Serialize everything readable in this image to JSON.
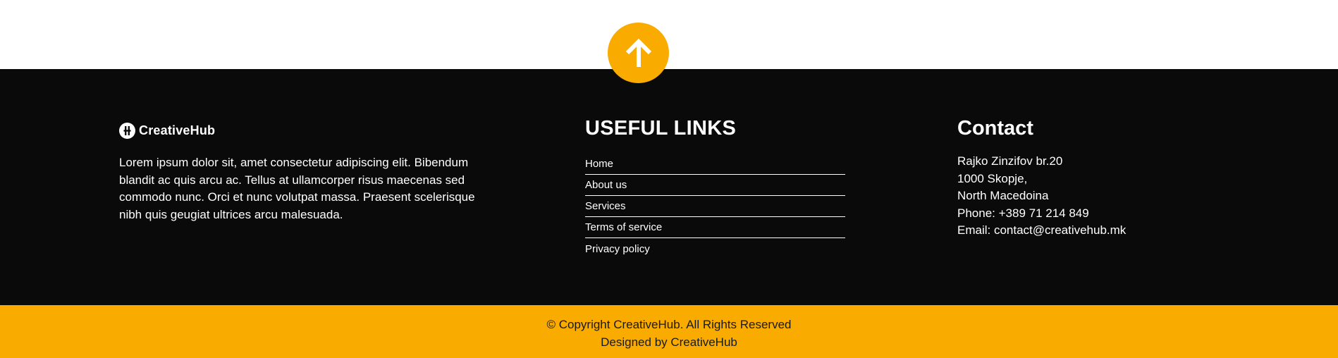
{
  "about": {
    "brand_name": "CreativeHub",
    "text": "Lorem ipsum dolor sit, amet consectetur adipiscing elit. Bibendum blandit ac quis arcu ac. Tellus at ullamcorper risus maecenas sed commodo nunc. Orci et nunc volutpat massa. Praesent scelerisque nibh quis geugiat ultrices arcu malesuada."
  },
  "links": {
    "title": "USEFUL LINKS",
    "items": [
      {
        "label": "Home"
      },
      {
        "label": "About us"
      },
      {
        "label": "Services"
      },
      {
        "label": "Terms of service"
      },
      {
        "label": "Privacy policy"
      }
    ]
  },
  "contact": {
    "title": "Contact",
    "address_line1": "Rajko Zinzifov br.20",
    "address_line2": "1000 Skopje,",
    "address_line3": "North Macedoina",
    "phone": "Phone: +389 71 214 849",
    "email_prefix": "Email: ",
    "email": "contact@creativehub.mk"
  },
  "copyright": {
    "line1": "© Copyright CreativeHub. All Rights Reserved",
    "line2": "Designed by CreativeHub"
  },
  "icons": {
    "scroll_top": "arrow-up-icon",
    "brand_logo": "creativehub-logo-icon"
  },
  "colors": {
    "accent": "#f9ab00",
    "footer_bg": "#0a0a0a",
    "text_light": "#ffffff"
  }
}
